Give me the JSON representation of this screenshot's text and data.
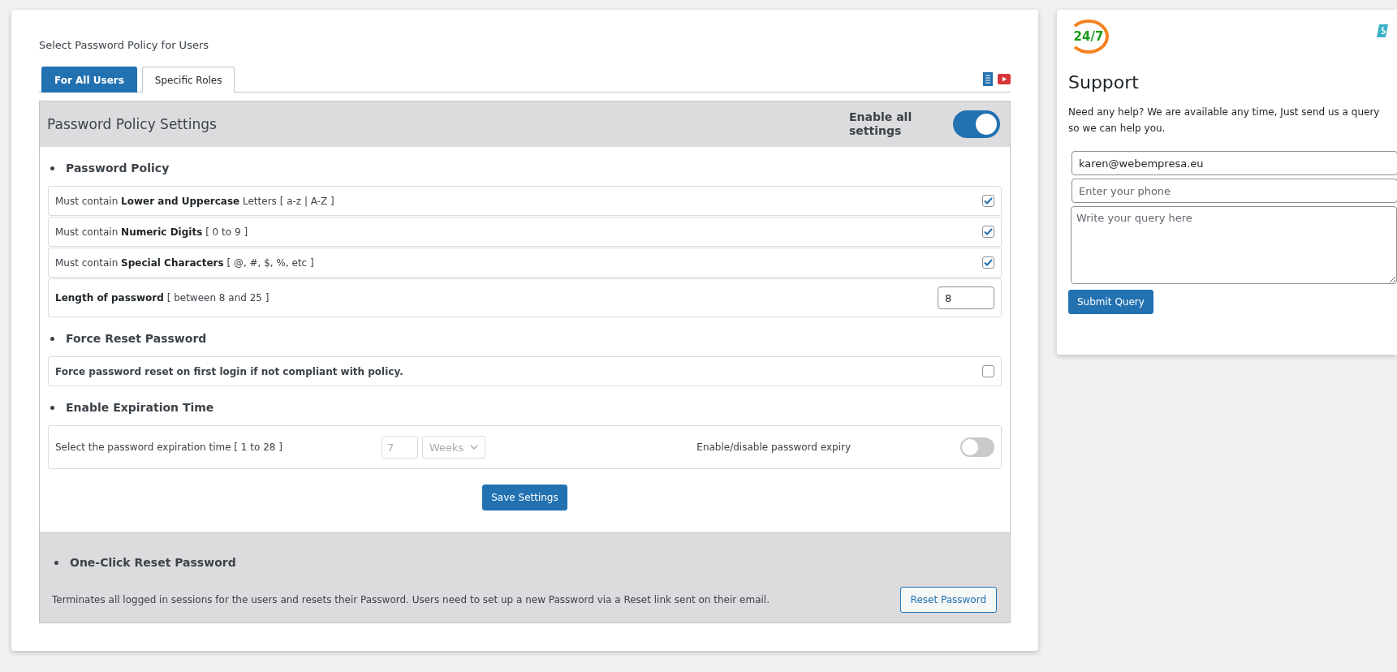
{
  "page_title": "Select Password Policy for Users",
  "tabs": [
    {
      "label": "For All Users",
      "selected": true
    },
    {
      "label": "Specific Roles",
      "selected": false
    }
  ],
  "settings": {
    "title": "Password Policy Settings",
    "enable_all_label": "Enable all settings",
    "enable_all_on": true
  },
  "sections": [
    {
      "heading": "Password Policy",
      "kind": "rules",
      "rows": [
        {
          "kind": "checkbox",
          "text": "Must contain **Lower and Uppercase** Letters [ a-z | A-Z ]",
          "checked": true
        },
        {
          "kind": "checkbox",
          "text": "Must contain **Numeric Digits** [ 0 to 9 ]",
          "checked": true
        },
        {
          "kind": "checkbox",
          "text": "Must contain **Special Characters** [ @, #, $, %, etc ]",
          "checked": true
        },
        {
          "kind": "number",
          "text": "**Length of password** [ between 8 and 25 ]",
          "value": "8"
        }
      ]
    },
    {
      "heading": "Force Reset Password",
      "kind": "force",
      "rows": [
        {
          "kind": "checkbox",
          "text": "Force password reset on first login if not compliant with policy.",
          "checked": false
        }
      ]
    },
    {
      "heading": "Enable Expiration Time",
      "kind": "expiry",
      "rows": [
        {
          "kind": "expiry",
          "text": "Select the password expiration time [ 1 to 28 ]",
          "value": "7",
          "unit": "Weeks",
          "toggle_label": "Enable/disable password expiry",
          "on": false
        }
      ]
    }
  ],
  "save_button": "Save Settings",
  "reset": {
    "heading": "One-Click Reset Password",
    "text": "Terminates all logged in sessions for the users and resets their Password. Users need to set up a new Password via a Reset link sent on their email.",
    "button": "Reset Password"
  },
  "support": {
    "logo": "24/7",
    "title": "Support",
    "text": "Need any help? We are available any time, Just send us a query so we can help you.",
    "email_value": "karen@webempresa.eu",
    "phone_placeholder": "Enter your phone",
    "query_placeholder": "Write your query here",
    "button": "Submit Query"
  }
}
